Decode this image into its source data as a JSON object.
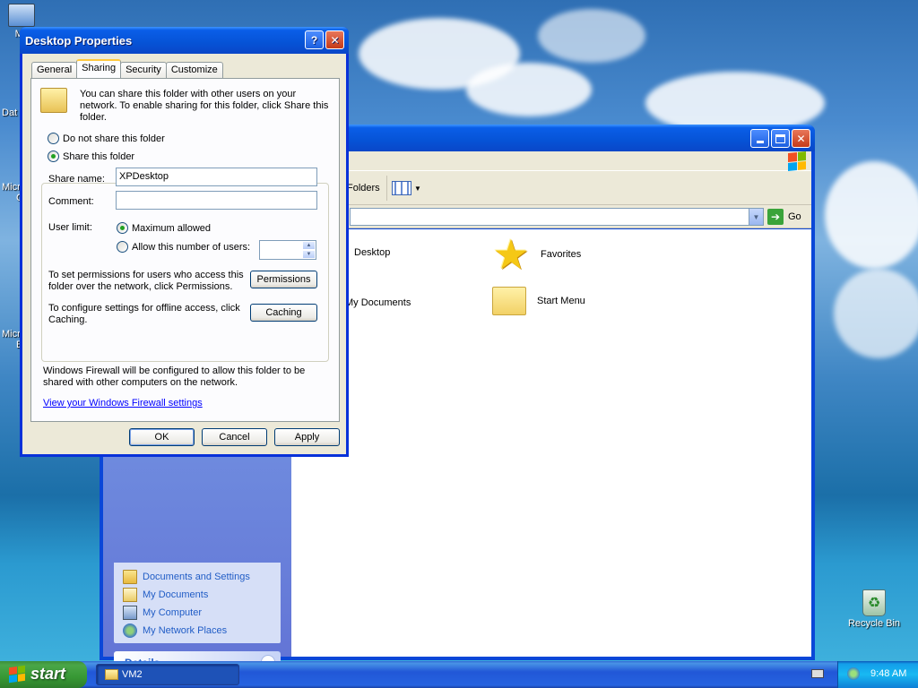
{
  "desktop": {
    "icons": [
      {
        "label": "My",
        "name": "my-computer"
      },
      {
        "label": "Dat",
        "name": "data"
      },
      {
        "label": "Micr",
        "name": "micro-1"
      },
      {
        "label": "C",
        "name": "micro-1b"
      },
      {
        "label": "Micr",
        "name": "micro-2"
      },
      {
        "label": "B",
        "name": "micro-2b"
      }
    ],
    "recycle_bin": "Recycle Bin"
  },
  "explorer": {
    "toolbar_folders": "Folders",
    "go_label": "Go",
    "items": [
      {
        "label": "Desktop",
        "icon": "desktop-icon"
      },
      {
        "label": "Favorites",
        "icon": "star-icon"
      },
      {
        "label": "My Documents",
        "icon": "folder-icon"
      },
      {
        "label": "Start Menu",
        "icon": "folder-icon"
      }
    ],
    "other_places": [
      {
        "label": "Documents and Settings",
        "icon": "folder-icon"
      },
      {
        "label": "My Documents",
        "icon": "mydocs-icon"
      },
      {
        "label": "My Computer",
        "icon": "computer-icon"
      },
      {
        "label": "My Network Places",
        "icon": "network-icon"
      }
    ],
    "details_title": "Details"
  },
  "dialog": {
    "title": "Desktop Properties",
    "tabs": [
      "General",
      "Sharing",
      "Security",
      "Customize"
    ],
    "active_tab": "Sharing",
    "intro_text": "You can share this folder with other users on your network.  To enable sharing for this folder, click Share this folder.",
    "radio_no_share": "Do not share this folder",
    "radio_share": "Share this folder",
    "share_name_label": "Share name:",
    "share_name_value": "XPDesktop",
    "comment_label": "Comment:",
    "comment_value": "",
    "user_limit_label": "User limit:",
    "max_allowed": "Maximum allowed",
    "allow_number": "Allow this number of users:",
    "user_count": "",
    "permissions_text": "To set permissions for users who access this folder over the network, click Permissions.",
    "permissions_btn": "Permissions",
    "caching_text": "To configure settings for offline access, click Caching.",
    "caching_btn": "Caching",
    "firewall_text": "Windows Firewall will be configured to allow this folder to be shared with other computers on the network.",
    "firewall_link": "View your Windows Firewall settings",
    "ok": "OK",
    "cancel": "Cancel",
    "apply": "Apply"
  },
  "taskbar": {
    "start": "start",
    "task_item": "VM2",
    "clock": "9:48 AM"
  },
  "colors": {
    "xp_blue": "#0a47d8",
    "link_blue": "#215dc6",
    "start_green": "#3c8e3a"
  }
}
